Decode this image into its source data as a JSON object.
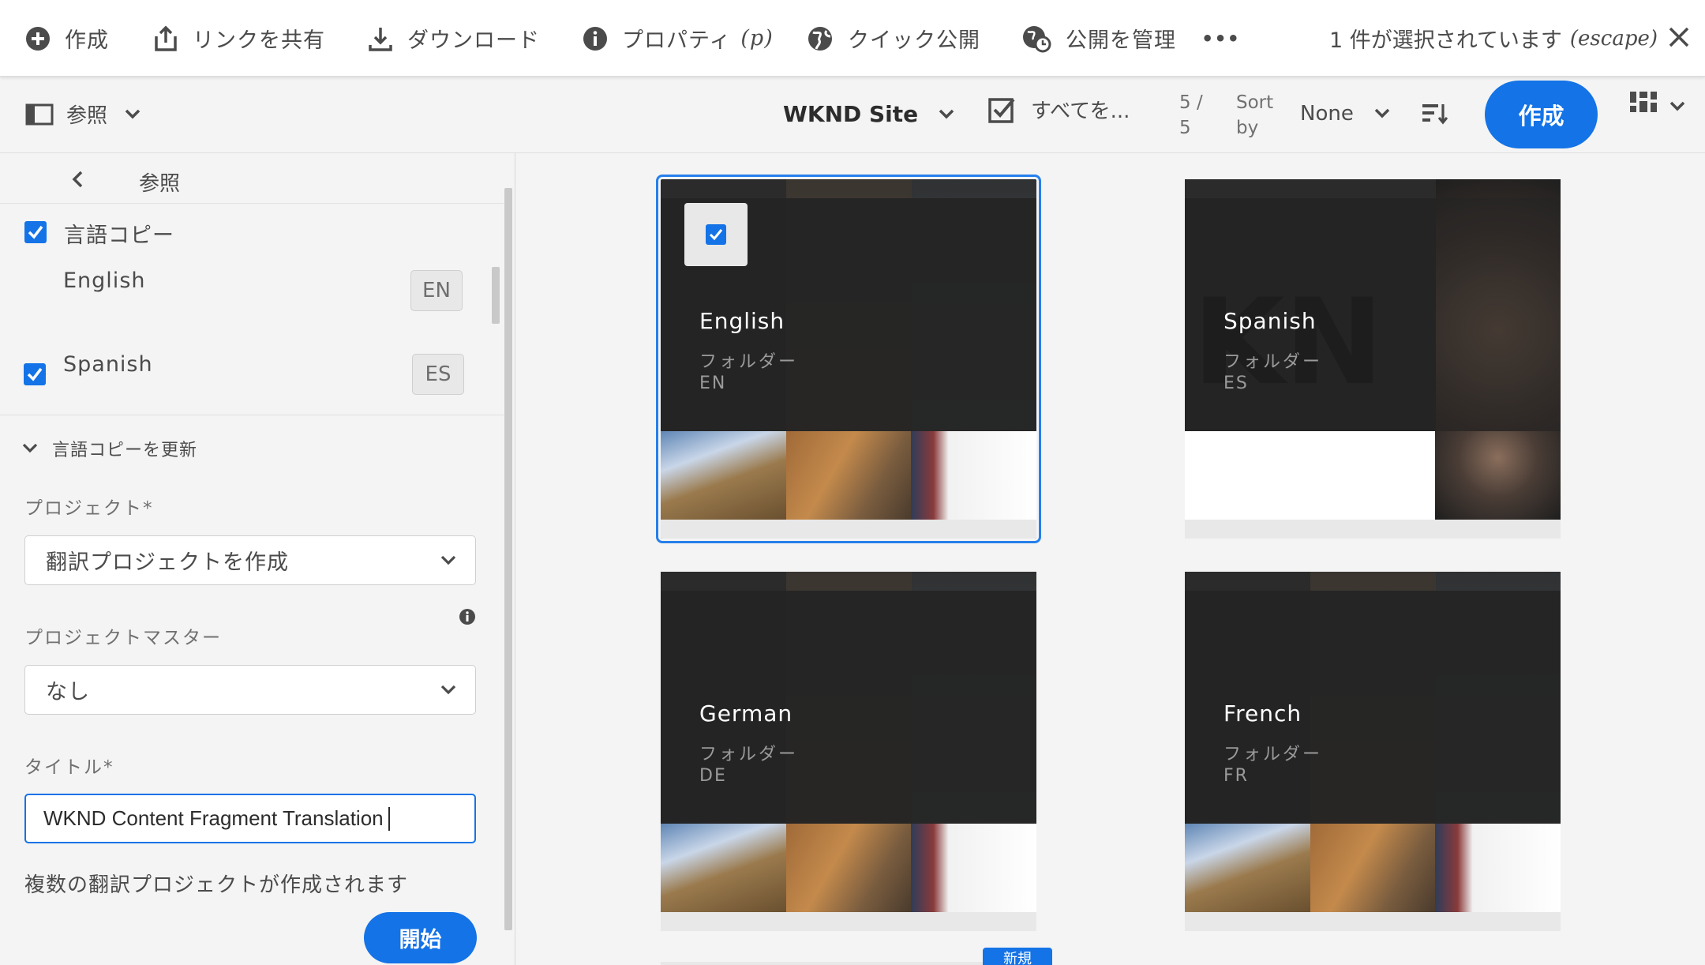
{
  "actionbar": {
    "create": "作成",
    "share_link": "リンクを共有",
    "download": "ダウンロード",
    "properties": "プロパティ",
    "properties_shortcut": "(p)",
    "quick_publish": "クイック公開",
    "manage_publication": "公開を管理",
    "more": "•••",
    "selection_text": "1 件が選択されています",
    "selection_hint": "(escape)"
  },
  "toolbar": {
    "rail_toggle": "参照",
    "breadcrumb": "WKND Site",
    "select_all": "すべてを...",
    "count_top": "5 /",
    "count_bottom": "5",
    "sort_label_top": "Sort",
    "sort_label_bottom": "by",
    "sort_value": "None",
    "create_button": "作成"
  },
  "rail": {
    "back_title": "参照",
    "language_copies_label": "言語コピー",
    "languages": [
      {
        "name": "English",
        "code": "EN",
        "checked": false
      },
      {
        "name": "Spanish",
        "code": "ES",
        "checked": true
      }
    ],
    "update_section": "言語コピーを更新",
    "project_label": "プロジェクト*",
    "project_value": "翻訳プロジェクトを作成",
    "project_master_label": "プロジェクトマスター",
    "project_master_value": "なし",
    "title_label": "タイトル*",
    "title_value": "WKND Content Fragment Translation",
    "help_text": "複数の翻訳プロジェクトが作成されます",
    "start_button": "開始"
  },
  "cards": [
    {
      "title": "English",
      "type": "フォルダー",
      "code": "EN",
      "selected": true
    },
    {
      "title": "Spanish",
      "type": "フォルダー",
      "code": "ES",
      "selected": false
    },
    {
      "title": "German",
      "type": "フォルダー",
      "code": "DE",
      "selected": false
    },
    {
      "title": "French",
      "type": "フォルダー",
      "code": "FR",
      "selected": false
    }
  ],
  "partial_badge": "新規",
  "colors": {
    "accent": "#1473e6",
    "selection_outline": "#2680eb",
    "card_dark": "#242424"
  }
}
